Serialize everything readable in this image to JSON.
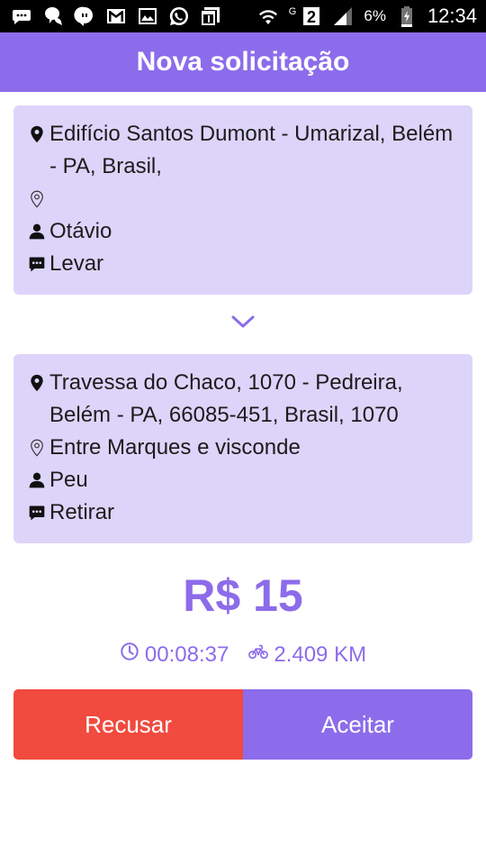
{
  "status_bar": {
    "g_label": "G",
    "sim_label": "2",
    "battery": "6%",
    "time": "12:34",
    "icons": [
      "chat-icon",
      "hangouts-icon",
      "messenger-icon",
      "gmail-icon",
      "photos-icon",
      "whatsapp-icon",
      "window-icon",
      "wifi-icon",
      "signal-icon",
      "battery-icon"
    ]
  },
  "header": {
    "title": "Nova solicitação"
  },
  "pickup": {
    "address": "Edifício Santos Dumont - Umarizal, Belém - PA, Brasil,",
    "reference": "",
    "contact": "Otávio",
    "instruction": "Levar"
  },
  "dropoff": {
    "address": "Travessa do Chaco, 1070 - Pedreira, Belém - PA, 66085-451, Brasil, 1070",
    "reference": "Entre Marques e visconde",
    "contact": "Peu",
    "instruction": "Retirar"
  },
  "summary": {
    "price": "R$ 15",
    "duration": "00:08:37",
    "distance": "2.409 KM"
  },
  "actions": {
    "decline_label": "Recusar",
    "accept_label": "Aceitar"
  },
  "colors": {
    "accent": "#8c6cea",
    "card_bg": "#ddd4fa",
    "decline": "#f14a3e"
  }
}
